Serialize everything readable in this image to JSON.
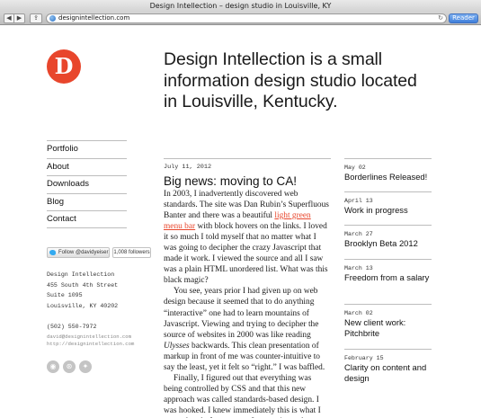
{
  "browser": {
    "window_title": "Design Intellection – design studio in Louisville, KY",
    "back_glyph": "◀",
    "forward_glyph": "▶",
    "share_glyph": "⇪",
    "url": "designintellection.com",
    "reload_glyph": "↻",
    "reader_label": "Reader"
  },
  "site": {
    "logo_letter": "D",
    "logo_color": "#e8462c",
    "headline": "Design Intellection is a small information design studio located in Louisville, Kentucky."
  },
  "nav": {
    "items": [
      "Portfolio",
      "About",
      "Downloads",
      "Blog",
      "Contact"
    ]
  },
  "twitter": {
    "follow_label": "Follow @davidyeiser",
    "followers": "1,008 followers"
  },
  "address": {
    "name": "Design Intellection",
    "street": "455 South 4th Street",
    "suite": "Suite 1095",
    "city": "Louisville, KY 40202",
    "phone": "(502) 550-7972",
    "email": "david@designintellection.com",
    "website": "http://designintellection.com"
  },
  "social": {
    "icons": [
      "rss-icon",
      "dribbble-icon",
      "twitter-icon"
    ],
    "rss_glyph": "◉",
    "dribbble_glyph": "⊛",
    "twitter_glyph": "✦"
  },
  "article": {
    "date": "July 11, 2012",
    "title": "Big news: moving to CA!",
    "p1_a": "In 2003, I inadvertently discovered web standards. The site was Dan Rubin’s Superfluous Banter and there was a beautiful ",
    "p1_link": "light green menu bar",
    "p1_b": " with block hovers on the links. I loved it so much I told myself that no matter what I was going to decipher the crazy Javascript that made it work. I viewed the source and all I saw was a plain HTML unordered list. What was this black magic?",
    "p2_a": "You see, years prior I had given up on web design because it seemed that to do anything “interactive” one had to learn mountains of Javascript. Viewing and trying to decipher the source of websites in 2000 was like reading ",
    "p2_em": "Ulysses",
    "p2_b": " backwards. This clean presentation of markup in front of me was counter-intuitive to say the least, yet it felt so “right.” I was baffled.",
    "p3": "Finally, I figured out that everything was being controlled by CSS and that this new approach was called standards-based design. I was hooked. I knew immediately this is what I wanted to do for a career. I was going to be a web designer. But not"
  },
  "sidebar_posts": [
    {
      "date": "May 02",
      "title": "Borderlines Released!"
    },
    {
      "date": "April 13",
      "title": "Work in progress"
    },
    {
      "date": "March 27",
      "title": "Brooklyn Beta 2012"
    },
    {
      "date": "March 13",
      "title": "Freedom from a salary"
    },
    {
      "date": "March 02",
      "title": "New client work: Pitchbrite"
    },
    {
      "date": "February 15",
      "title": "Clarity on content and design"
    }
  ]
}
